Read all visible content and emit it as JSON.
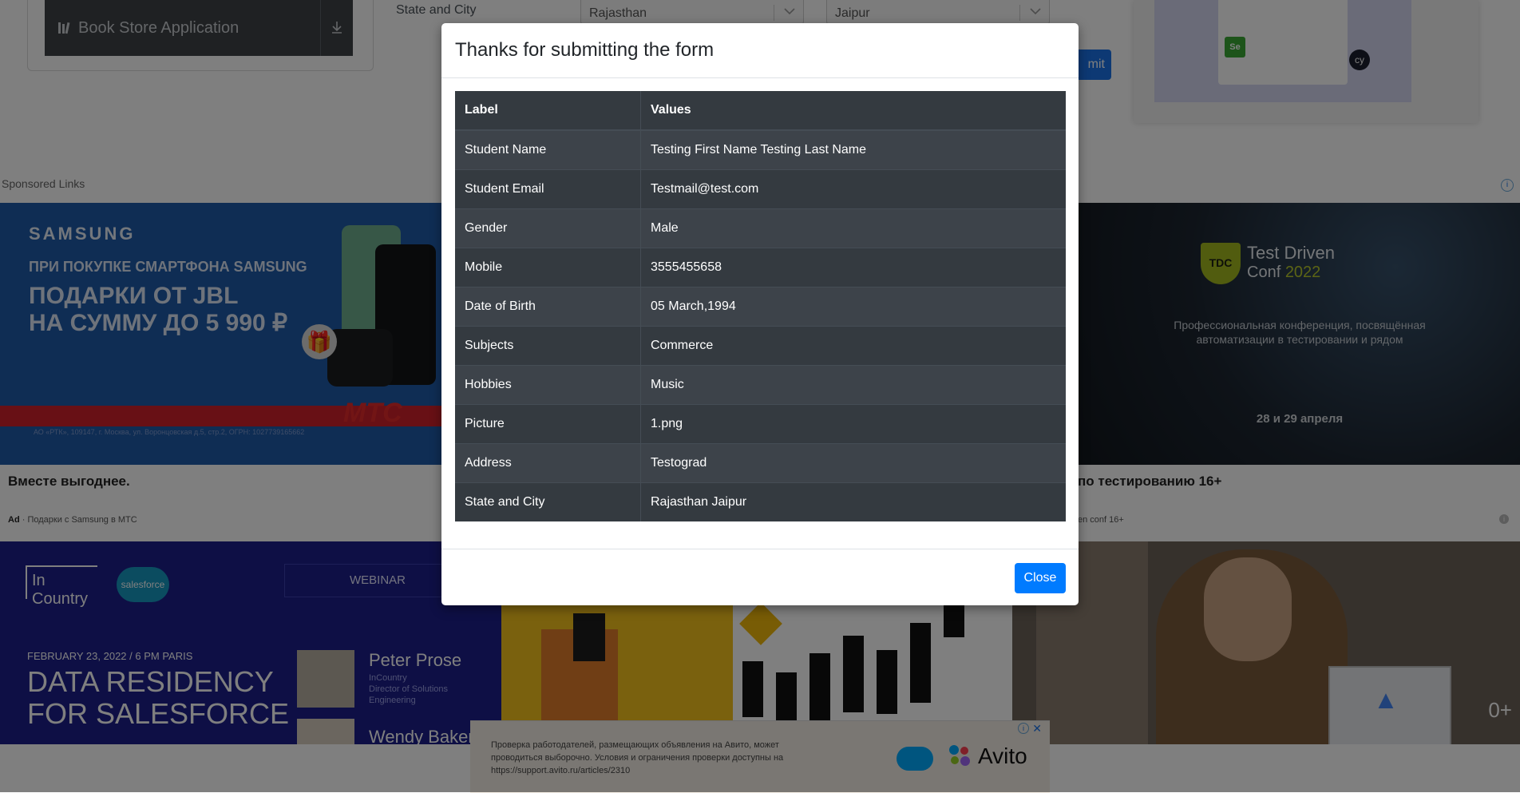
{
  "background": {
    "sidebar": {
      "book_store_label": "Book Store Application"
    },
    "form": {
      "state_city_label": "State and City",
      "state_value": "Rajasthan",
      "city_value": "Jaipur",
      "submit_fragment": "mit"
    },
    "sponsored_label": "Sponsored Links",
    "ads": {
      "samsung": {
        "brand": "SAMSUNG",
        "line1": "ПРИ ПОКУПКЕ СМАРТФОНА SAMSUNG",
        "line2a": "ПОДАРКИ ОТ JBL",
        "line2b": "НА СУММУ ДО 5 990 ₽",
        "mts": "МТС",
        "legal": "АО «РТК», 109147, г. Москва, ул. Воронцовская д.5, стр.2, ОГРН: 1027739165662",
        "title": "Вместе выгоднее.",
        "ad_label": "Ad",
        "meta": "Подарки с Samsung в МТС"
      },
      "tdc": {
        "shield": "TDC",
        "title1": "Test Driven",
        "title2a": "Conf",
        "title2b": "2022",
        "desc": "Профессиональная конференция, посвящённая автоматизации в тестировании и рядом",
        "date": "28 и 29 апреля",
        "headline": "по тестированию 16+",
        "meta": "en conf 16+"
      },
      "incountry": {
        "logo": "In Country",
        "salesforce": "salesforce",
        "webinar": "WEBINAR",
        "date": "FEBRUARY 23, 2022 / 6 PM PARIS",
        "headline1": "DATA RESIDENCY",
        "headline2": "FOR SALESFORCE",
        "speaker1_name": "Peter Prose",
        "speaker1_role": "InCountry\nDirector of Solutions\nEngineering",
        "speaker2_name": "Wendy Baker"
      },
      "workshop": {
        "overlay": "0+"
      },
      "avito": {
        "text": "Проверка работодателей, размещающих объявления на Авито, может проводиться выборочно. Условия и ограничения проверки доступны на https://support.avito.ru/articles/2310",
        "brand": "Avito"
      }
    }
  },
  "modal": {
    "title": "Thanks for submitting the form",
    "table_headers": [
      "Label",
      "Values"
    ],
    "rows": [
      {
        "label": "Student Name",
        "value": "Testing First Name Testing Last Name"
      },
      {
        "label": "Student Email",
        "value": "Testmail@test.com"
      },
      {
        "label": "Gender",
        "value": "Male"
      },
      {
        "label": "Mobile",
        "value": "3555455658"
      },
      {
        "label": "Date of Birth",
        "value": "05 March,1994"
      },
      {
        "label": "Subjects",
        "value": "Commerce"
      },
      {
        "label": "Hobbies",
        "value": "Music"
      },
      {
        "label": "Picture",
        "value": "1.png"
      },
      {
        "label": "Address",
        "value": "Testograd"
      },
      {
        "label": "State and City",
        "value": "Rajasthan Jaipur"
      }
    ],
    "close_label": "Close"
  },
  "colors": {
    "primary": "#007bff",
    "table_dark": "#343a40",
    "backdrop": "rgba(0,0,0,0.5)"
  }
}
